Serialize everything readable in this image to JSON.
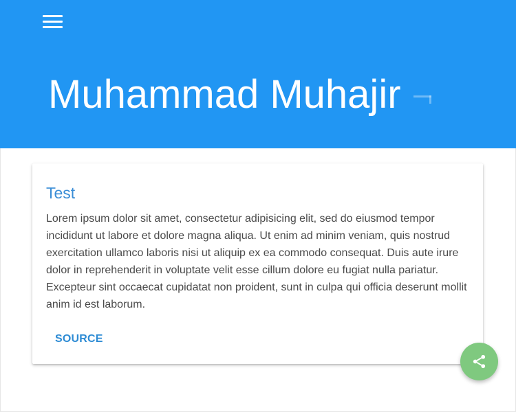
{
  "header": {
    "title": "Muhammad Muhajir",
    "background_color": "#2196f3",
    "menu_icon": "hamburger-menu-icon"
  },
  "card": {
    "title": "Test",
    "body": "Lorem ipsum dolor sit amet, consectetur adipisicing elit, sed do eiusmod tempor incididunt ut labore et dolore magna aliqua. Ut enim ad minim veniam, quis nostrud exercitation ullamco laboris nisi ut aliquip ex ea commodo consequat. Duis aute irure dolor in reprehenderit in voluptate velit esse cillum dolore eu fugiat nulla pariatur. Excepteur sint occaecat cupidatat non proident, sunt in culpa qui officia deserunt mollit anim id est laborum.",
    "action_label": "SOURCE",
    "title_color": "#3a8dd6"
  },
  "fab": {
    "icon": "share-icon",
    "color": "#7fc97f"
  }
}
